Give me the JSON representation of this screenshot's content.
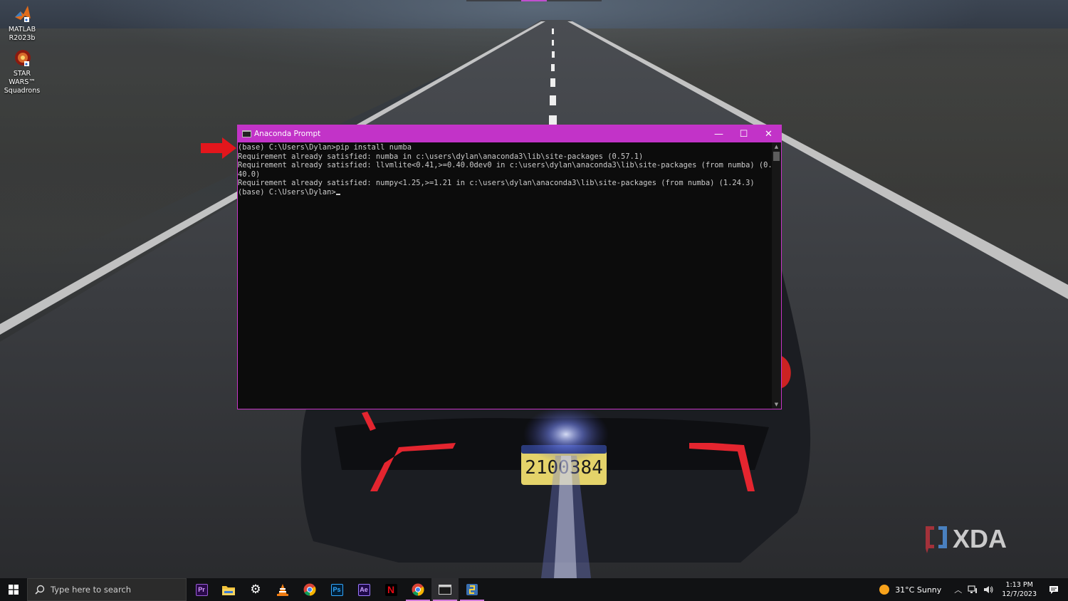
{
  "desktop": {
    "icons": [
      {
        "label_line1": "MATLAB",
        "label_line2": "R2023b",
        "icon": "matlab-icon"
      },
      {
        "label_line1": "STAR WARS™",
        "label_line2": "Squadrons",
        "icon": "star-wars-squadrons-icon"
      }
    ],
    "watermark": "XDA"
  },
  "window": {
    "title": "Anaconda Prompt",
    "minimize": "—",
    "maximize": "☐",
    "close": "✕",
    "accent_color": "#c233c8",
    "lines": [
      "(base) C:\\Users\\Dylan>pip install numba",
      "Requirement already satisfied: numba in c:\\users\\dylan\\anaconda3\\lib\\site-packages (0.57.1)",
      "Requirement already satisfied: llvmlite<0.41,>=0.40.0dev0 in c:\\users\\dylan\\anaconda3\\lib\\site-packages (from numba) (0.",
      "40.0)",
      "Requirement already satisfied: numpy<1.25,>=1.21 in c:\\users\\dylan\\anaconda3\\lib\\site-packages (from numba) (1.24.3)",
      "",
      "(base) C:\\Users\\Dylan>"
    ]
  },
  "taskbar": {
    "search_placeholder": "Type here to search",
    "apps": [
      {
        "name": "premiere-pro",
        "label": "Pr",
        "color": "#2a0a4a",
        "fg": "#d79cff"
      },
      {
        "name": "file-explorer",
        "label": "",
        "color": "#f2c23a"
      },
      {
        "name": "settings",
        "label": "⚙",
        "color": ""
      },
      {
        "name": "vlc",
        "label": "",
        "color": "#f07c12"
      },
      {
        "name": "chrome",
        "label": "",
        "color": ""
      },
      {
        "name": "photoshop",
        "label": "Ps",
        "color": "#001e36",
        "fg": "#31a8ff"
      },
      {
        "name": "after-effects",
        "label": "Ae",
        "color": "#1f0a4a",
        "fg": "#c9a1ff"
      },
      {
        "name": "netflix",
        "label": "N",
        "color": "#000000",
        "fg": "#e50914"
      },
      {
        "name": "chrome-2",
        "label": "",
        "color": ""
      },
      {
        "name": "anaconda-prompt",
        "label": "",
        "color": ""
      },
      {
        "name": "python",
        "label": "",
        "color": ""
      }
    ],
    "weather": "31°C  Sunny",
    "time": "1:13 PM",
    "date": "12/7/2023"
  }
}
